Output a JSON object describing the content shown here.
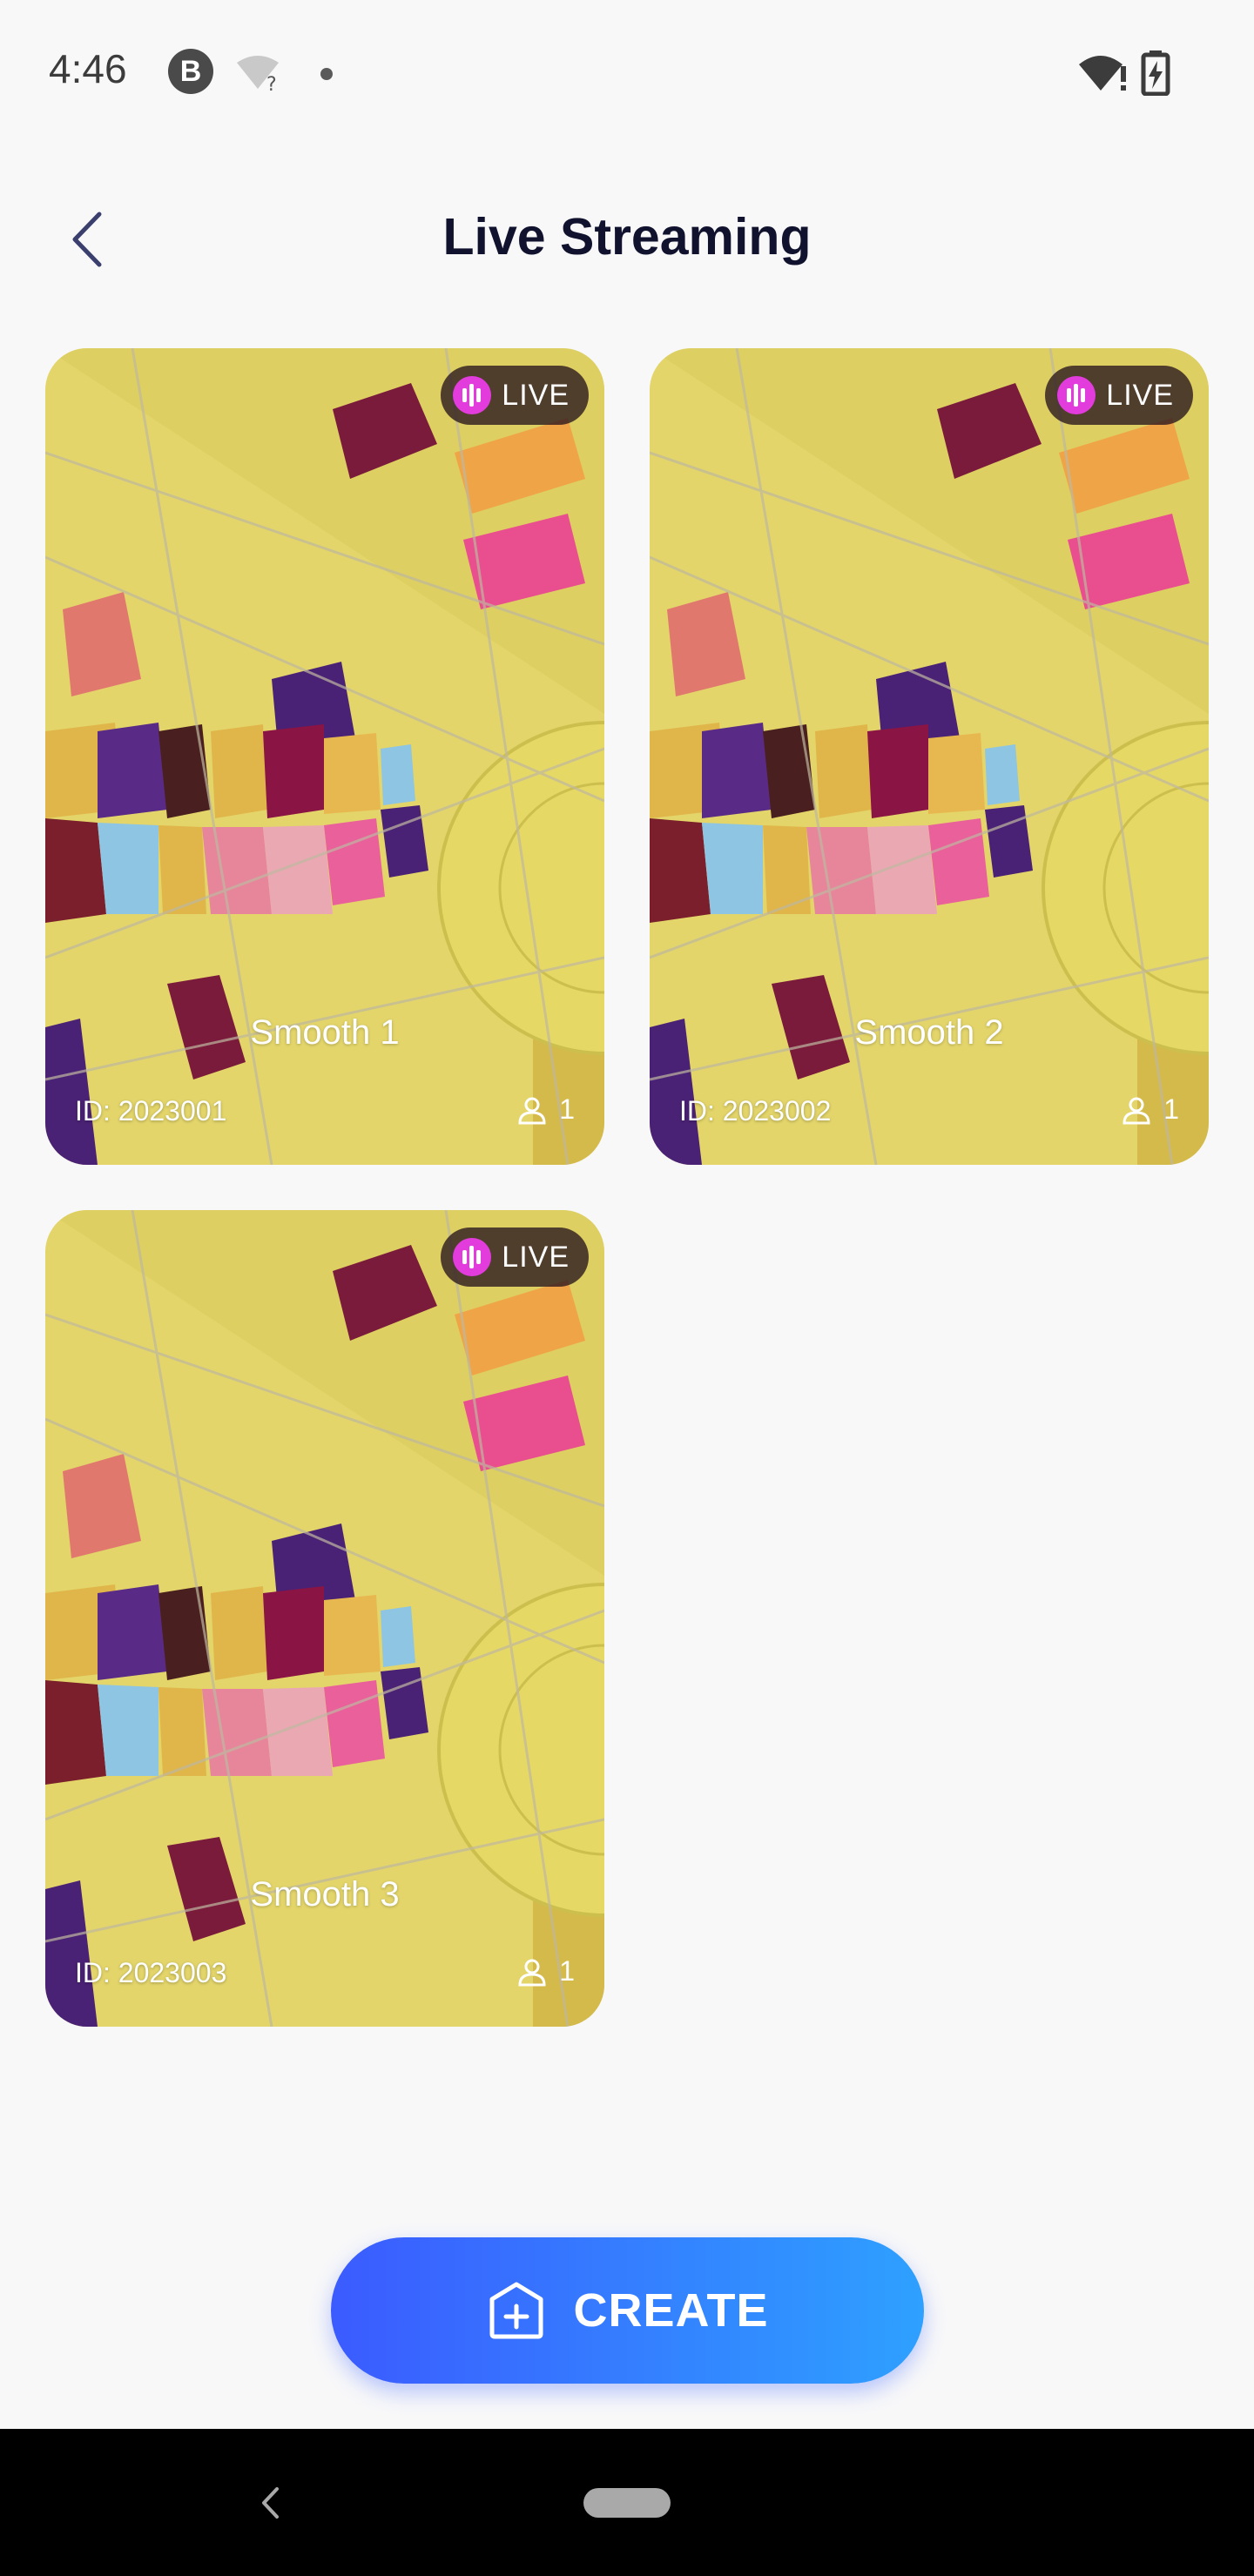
{
  "status_bar": {
    "time": "4:46",
    "notification_icon_letter": "B",
    "icons": [
      "b-notification-icon",
      "wifi-unknown-icon",
      "dot-icon",
      "wifi-alert-icon",
      "battery-charging-icon"
    ]
  },
  "header": {
    "title": "Live Streaming",
    "back_icon": "chevron-left-icon"
  },
  "rooms": [
    {
      "title": "Smooth 1",
      "id_text": "ID: 2023001",
      "badge": "LIVE",
      "viewers": "1"
    },
    {
      "title": "Smooth 2",
      "id_text": "ID: 2023002",
      "badge": "LIVE",
      "viewers": "1"
    },
    {
      "title": "Smooth 3",
      "id_text": "ID: 2023003",
      "badge": "LIVE",
      "viewers": "1"
    }
  ],
  "create_button": {
    "label": "CREATE",
    "icon": "add-room-icon"
  },
  "colors": {
    "accent_start": "#3b5bff",
    "accent_end": "#2ea0ff",
    "live_dot": "#e23cdc",
    "title": "#10122e"
  }
}
